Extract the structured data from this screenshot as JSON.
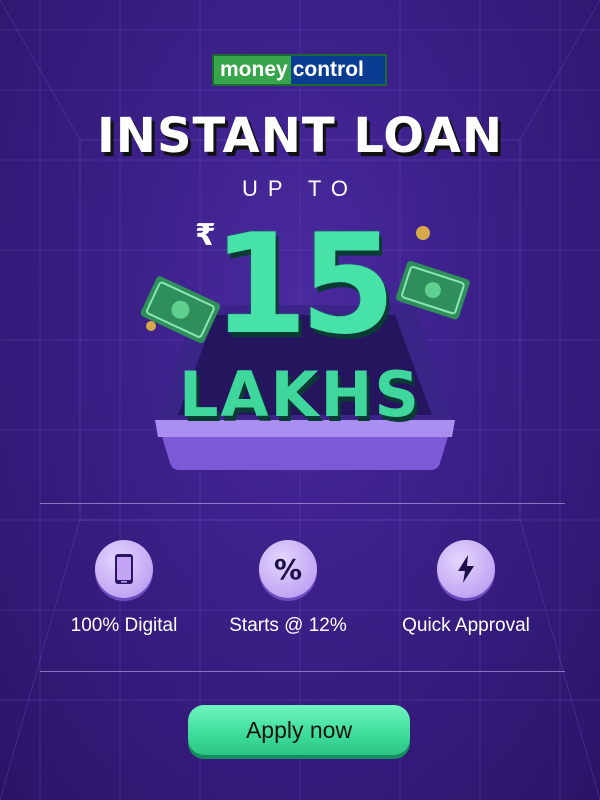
{
  "brand": {
    "money": "money",
    "control": "control"
  },
  "headline": {
    "title": "INSTANT LOAN",
    "up_to": "UP TO",
    "currency": "₹",
    "amount": "15",
    "unit": "LAKHS"
  },
  "features": [
    {
      "icon": "smartphone-icon",
      "label": "100% Digital"
    },
    {
      "icon": "percent-icon",
      "label": "Starts @ 12%"
    },
    {
      "icon": "lightning-icon",
      "label": "Quick Approval"
    }
  ],
  "cta": {
    "label": "Apply now"
  },
  "colors": {
    "background": "#3a1f86",
    "accent": "#46e2a8",
    "icon_circle": "#c2a6f3"
  }
}
